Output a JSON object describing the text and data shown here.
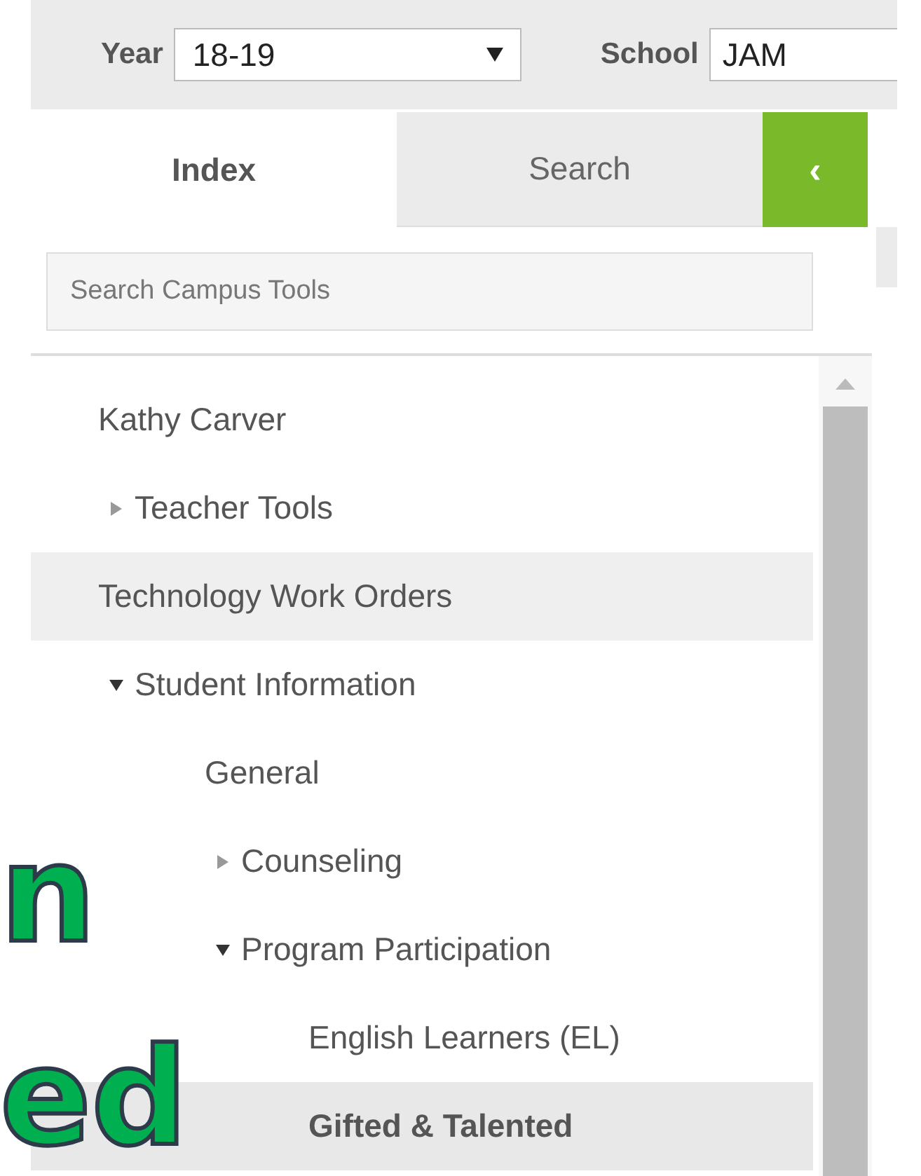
{
  "toolbar": {
    "year_label": "Year",
    "year_value": "18-19",
    "school_label": "School",
    "school_value": "JAM"
  },
  "tabs": [
    {
      "label": "Index",
      "selected": true
    },
    {
      "label": "Search",
      "selected": false
    }
  ],
  "collapse_button": {
    "label": "‹"
  },
  "search": {
    "placeholder": "Search Campus Tools"
  },
  "tree": [
    {
      "label": "Kathy Carver",
      "kind": "leaf",
      "selected": false,
      "highlighted": false
    },
    {
      "label": "Teacher Tools",
      "kind": "folder",
      "expanded": false,
      "selected": false,
      "highlighted": false
    },
    {
      "label": "Technology Work Orders",
      "kind": "leaf",
      "selected": false,
      "highlighted": true
    },
    {
      "label": "Student Information",
      "kind": "folder",
      "expanded": true,
      "selected": false,
      "highlighted": false,
      "children": [
        {
          "label": "General",
          "kind": "leaf",
          "selected": false,
          "highlighted": false
        },
        {
          "label": "Counseling",
          "kind": "folder",
          "expanded": false,
          "selected": false,
          "highlighted": false
        },
        {
          "label": "Program Participation",
          "kind": "folder",
          "expanded": true,
          "selected": false,
          "highlighted": false,
          "children": [
            {
              "label": "English Learners (EL)",
              "kind": "leaf",
              "selected": false,
              "highlighted": false
            },
            {
              "label": "Gifted & Talented",
              "kind": "leaf",
              "selected": true,
              "highlighted": false
            }
          ]
        }
      ]
    }
  ],
  "overlay_texts": [
    "n",
    "ed"
  ]
}
